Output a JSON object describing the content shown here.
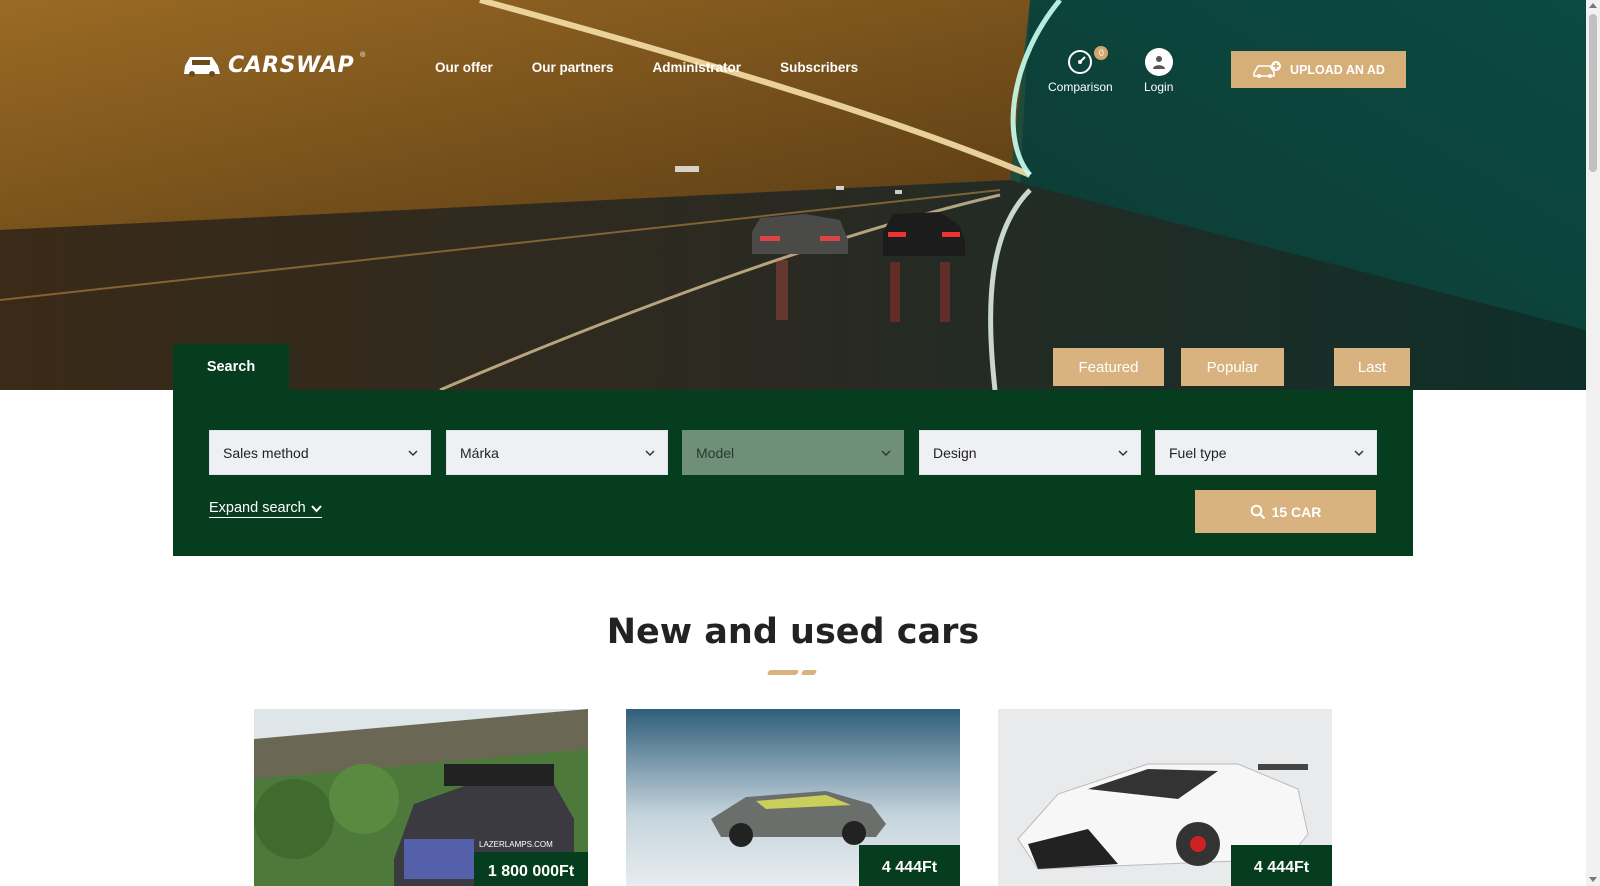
{
  "header": {
    "logo_text": "CARSWAP",
    "logo_reg": "®",
    "nav": [
      {
        "label": "Our offer"
      },
      {
        "label": "Our partners"
      },
      {
        "label": "Administrator"
      },
      {
        "label": "Subscribers"
      }
    ],
    "comparison_label": "Comparison",
    "comparison_count": "0",
    "login_label": "Login",
    "upload_label": "UPLOAD AN AD"
  },
  "tabs": {
    "search": "Search",
    "featured": "Featured",
    "popular": "Popular",
    "last": "Last"
  },
  "search": {
    "selects": [
      {
        "label": "Sales method",
        "disabled": false
      },
      {
        "label": "Márka",
        "disabled": false
      },
      {
        "label": "Model",
        "disabled": true
      },
      {
        "label": "Design",
        "disabled": false
      },
      {
        "label": "Fuel type",
        "disabled": false
      }
    ],
    "expand_label": "Expand search",
    "button_label": "15 CAR"
  },
  "section": {
    "title": "New and used cars"
  },
  "cards": [
    {
      "price": "1 800 000Ft",
      "image_icon": "pickup-truck-photo"
    },
    {
      "price": "4 444Ft",
      "image_icon": "concept-car-photo"
    },
    {
      "price": "4 444Ft",
      "image_icon": "hypercar-photo"
    }
  ],
  "colors": {
    "brand_green": "#063d1e",
    "accent_gold": "#d8b37f"
  }
}
